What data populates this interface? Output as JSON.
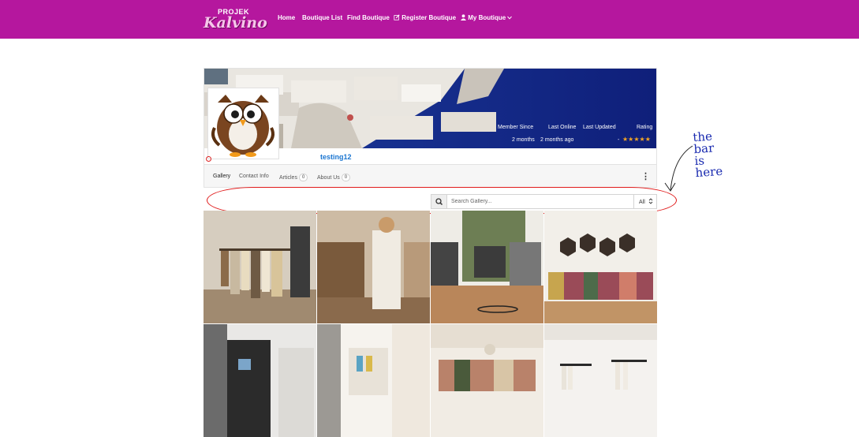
{
  "nav": {
    "logo_line1": "PROJEK",
    "logo_line2": "Kalvino",
    "items": [
      {
        "label": "Home"
      },
      {
        "label": "Boutique List"
      },
      {
        "label": "Find Boutique"
      },
      {
        "label": "Register Boutique",
        "icon": "edit-icon"
      },
      {
        "label": "My Boutique",
        "icon": "user-icon",
        "dropdown": true
      }
    ],
    "bg_color": "#b5179e"
  },
  "profile": {
    "username": "testing12",
    "stats": {
      "member_since_label": "Member Since",
      "last_online_label": "Last Online",
      "last_updated_label": "Last Updated",
      "rating_label": "Rating",
      "member_since_value": "2 months",
      "last_online_value": "2 months ago",
      "last_updated_value": "-"
    },
    "rating_stars": 5
  },
  "tabs": [
    {
      "label": "Gallery",
      "active": true
    },
    {
      "label": "Contact Info"
    },
    {
      "label": "Articles",
      "count": "0"
    },
    {
      "label": "About Us",
      "count": "0"
    }
  ],
  "search": {
    "placeholder": "Search Gallery...",
    "filter_value": "All"
  },
  "annotation": {
    "lines": [
      "the",
      "bar",
      "is",
      "here"
    ]
  },
  "gallery": {
    "tiles": [
      {
        "name": "boutique-photo-1"
      },
      {
        "name": "boutique-photo-2"
      },
      {
        "name": "boutique-photo-3"
      },
      {
        "name": "boutique-photo-4"
      },
      {
        "name": "boutique-photo-5"
      },
      {
        "name": "boutique-photo-6"
      },
      {
        "name": "boutique-photo-7"
      },
      {
        "name": "boutique-photo-8"
      }
    ]
  }
}
